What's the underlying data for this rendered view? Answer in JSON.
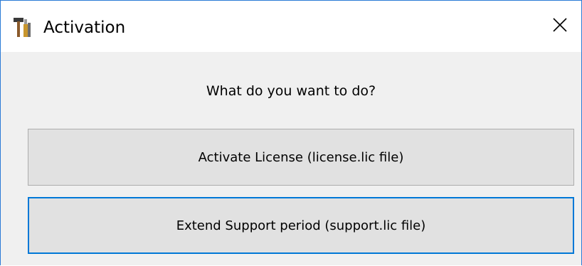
{
  "window": {
    "title": "Activation",
    "close_glyph": "✕",
    "app_icon": "tools-icon",
    "border_color": "#2b7bd6"
  },
  "dialog": {
    "prompt": "What do you want to do?",
    "buttons": [
      {
        "label": "Activate License (license.lic file)"
      },
      {
        "label": "Extend Support period (support.lic file)",
        "focused": true
      }
    ],
    "focus_color": "#0078d7"
  }
}
